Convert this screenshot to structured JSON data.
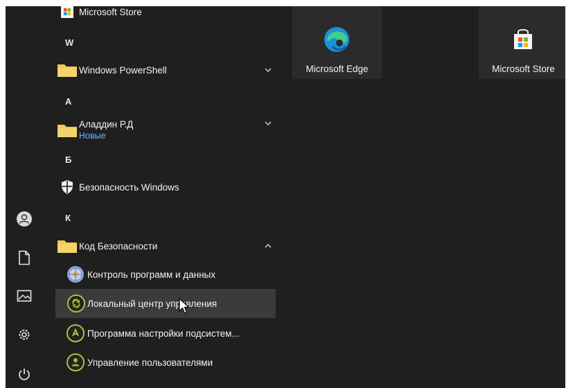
{
  "list": {
    "item_store": "Microsoft Store",
    "letter_w": "W",
    "item_powershell": "Windows PowerShell",
    "letter_a": "А",
    "item_aladdin": "Аладдин Р.Д",
    "item_aladdin_sub": "Новые",
    "letter_b": "Б",
    "item_security": "Безопасность Windows",
    "letter_k": "К",
    "item_kod": "Код Безопасности",
    "item_control": "Контроль программ и данных",
    "item_local": "Локальный центр управления",
    "item_settings": "Программа настройки подсистем...",
    "item_users": "Управление пользователями"
  },
  "tiles": {
    "edge": "Microsoft Edge",
    "store": "Microsoft Store"
  },
  "colors": {
    "background": "#1f1f1f",
    "tile": "#2b2b2b",
    "hover": "#3b3b3b",
    "folder": "#f2c94c",
    "accent_link": "#66b8ff"
  }
}
